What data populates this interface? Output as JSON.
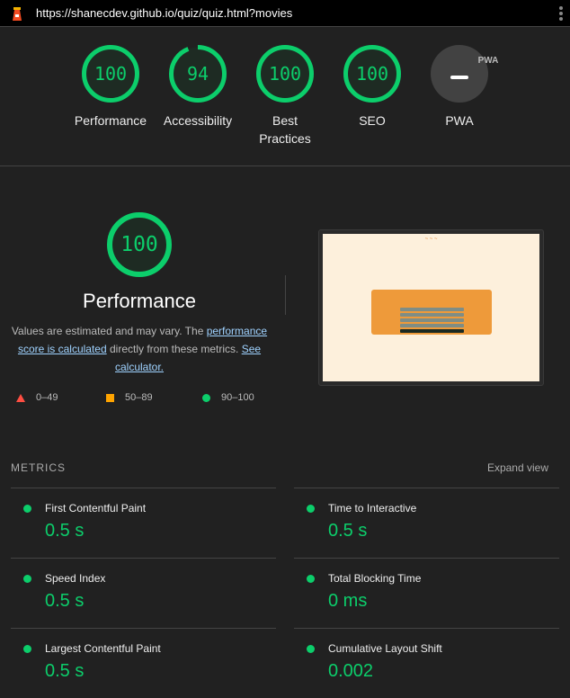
{
  "header": {
    "url": "https://shanecdev.github.io/quiz/quiz.html?movies"
  },
  "gauges": [
    {
      "label": "Performance",
      "score": "100",
      "value": 100
    },
    {
      "label": "Accessibility",
      "score": "94",
      "value": 94
    },
    {
      "label": "Best Practices",
      "score": "100",
      "value": 100
    },
    {
      "label": "SEO",
      "score": "100",
      "value": 100
    },
    {
      "label": "PWA",
      "badge": "PWA"
    }
  ],
  "performance": {
    "score": "100",
    "title": "Performance",
    "desc_1": "Values are estimated and may vary. The ",
    "link_1": "performance score is calculated",
    "desc_2": " directly from these metrics. ",
    "link_2": "See calculator."
  },
  "legend": [
    "0–49",
    "50–89",
    "90–100"
  ],
  "metrics": {
    "heading": "METRICS",
    "expand": "Expand view",
    "items": [
      {
        "label": "First Contentful Paint",
        "value": "0.5 s"
      },
      {
        "label": "Time to Interactive",
        "value": "0.5 s"
      },
      {
        "label": "Speed Index",
        "value": "0.5 s"
      },
      {
        "label": "Total Blocking Time",
        "value": "0 ms"
      },
      {
        "label": "Largest Contentful Paint",
        "value": "0.5 s"
      },
      {
        "label": "Cumulative Layout Shift",
        "value": "0.002"
      }
    ]
  },
  "colors": {
    "pass": "#0cce6b",
    "average": "#ffa400",
    "fail": "#ff4e42"
  }
}
